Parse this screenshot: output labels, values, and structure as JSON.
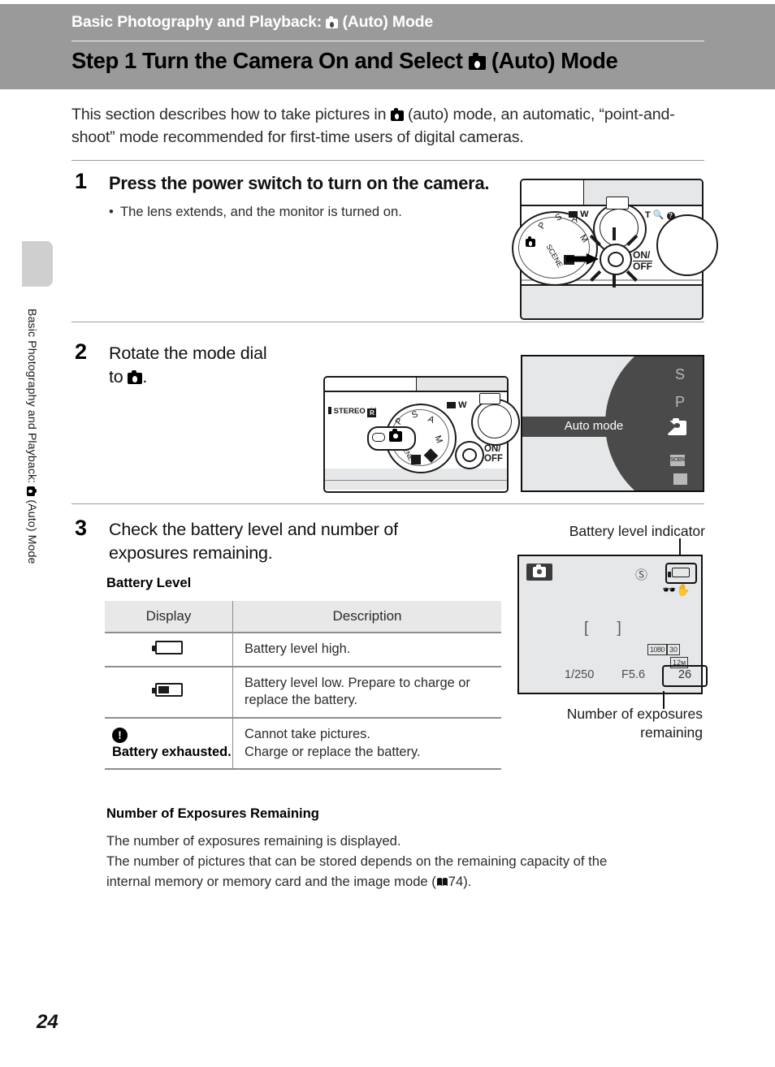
{
  "header": {
    "chapter": "Basic Photography and Playback:",
    "chapter_suffix": "(Auto) Mode",
    "title_prefix": "Step 1 Turn the Camera On and Select",
    "title_suffix": "(Auto) Mode",
    "background_color": "#9a9a9a"
  },
  "sidebar": {
    "tab_label": "",
    "vertical_text_prefix": "Basic Photography and Playback:",
    "vertical_text_suffix": "(Auto) Mode"
  },
  "intro": {
    "part1": "This section describes how to take pictures in",
    "part2": "(auto) mode, an automatic, “point-and-shoot” mode recommended for first-time users of digital cameras."
  },
  "steps": [
    {
      "number": "1",
      "heading": "Press the power switch to turn on the camera.",
      "bullet": "The lens extends, and the monitor is turned on."
    },
    {
      "number": "2",
      "heading_line1": "Rotate the mode dial",
      "heading_line2_prefix": "to",
      "heading_line2_suffix": "."
    },
    {
      "number": "3",
      "heading_line1": "Check the battery level and number of",
      "heading_line2": "exposures remaining.",
      "subheading": "Battery Level"
    }
  ],
  "battery_table": {
    "columns": [
      "Display",
      "Description"
    ],
    "rows": [
      {
        "display_icon": "battery-full-icon",
        "display_text": "",
        "description": "Battery level high."
      },
      {
        "display_icon": "battery-low-icon",
        "display_text": "",
        "description": "Battery level low. Prepare to charge or replace the battery."
      },
      {
        "display_icon": "warning-icon",
        "display_text": "Battery exhausted.",
        "description_line1": "Cannot take pictures.",
        "description_line2": "Charge or replace the battery."
      }
    ]
  },
  "exposures_section": {
    "heading": "Number of Exposures Remaining",
    "line1": "The number of exposures remaining is displayed.",
    "line2": "The number of pictures that can be stored depends on the remaining capacity of the",
    "line3_prefix": "internal memory or memory card and the image mode (",
    "line3_suffix": "74)."
  },
  "illustration_step1": {
    "zoom_wide_label": "W",
    "zoom_tele_label": "T",
    "power_label_line1": "ON/",
    "power_label_line2": "OFF",
    "dial_positions": [
      "P",
      "S",
      "A",
      "M",
      "SCENE"
    ]
  },
  "illustration_step2": {
    "stereo_label": "STEREO",
    "stereo_r": "R",
    "zoom_wide_label": "W",
    "power_label_line1": "ON/",
    "power_label_line2": "OFF",
    "dial_positions": [
      "P",
      "S",
      "A",
      "M",
      "SCENE"
    ]
  },
  "mode_monitor": {
    "banner_label": "Auto mode",
    "options": [
      "S",
      "P",
      "camera-auto-icon",
      "SCENE",
      "special-effects-icon"
    ],
    "selected": "camera-auto-icon",
    "band_color": "#4a4a4a",
    "background_color": "#e6e7e8"
  },
  "live_view_monitor": {
    "caption_top": "Battery level indicator",
    "caption_bottom_line1": "Number of exposures",
    "caption_bottom_line2": "remaining",
    "mode_icon": "camera-auto-icon",
    "flash_icon": "flash-off-icon",
    "battery_icon": "battery-full-icon",
    "vr_icon": "vibration-reduction-icon",
    "focus_brackets": "[    ]",
    "movie_quality": "1080",
    "frame_rate": "30",
    "image_size": "12м",
    "shutter_speed": "1/250",
    "aperture": "F5.6",
    "exposures_remaining": "26",
    "background_color": "#e6e7e8"
  },
  "footer": {
    "page_number": "24"
  }
}
